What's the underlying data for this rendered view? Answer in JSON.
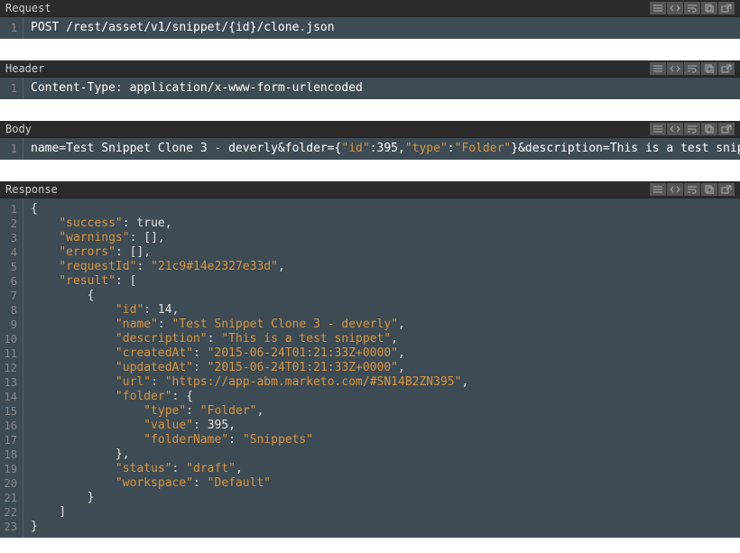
{
  "panels": {
    "request": {
      "title": "Request",
      "lines": [
        "1"
      ],
      "tokens": [
        [
          {
            "t": "POST /rest/asset/v1/snippet/{id}/clone.json",
            "c": "tok-ws"
          }
        ]
      ]
    },
    "header": {
      "title": "Header",
      "lines": [
        "1"
      ],
      "tokens": [
        [
          {
            "t": "Content-Type: application/x-www-form-urlencoded",
            "c": "tok-ws"
          }
        ]
      ]
    },
    "body": {
      "title": "Body",
      "lines": [
        "1"
      ],
      "tokens": [
        [
          {
            "t": "name=Test Snippet Clone 3 - deverly&folder={",
            "c": "tok-ws"
          },
          {
            "t": "\"id\"",
            "c": "tok-bkey"
          },
          {
            "t": ":395,",
            "c": "tok-ws"
          },
          {
            "t": "\"type\"",
            "c": "tok-bkey"
          },
          {
            "t": ":",
            "c": "tok-ws"
          },
          {
            "t": "\"Folder\"",
            "c": "tok-bkey"
          },
          {
            "t": "}&description=This is a test snippet",
            "c": "tok-ws"
          }
        ]
      ]
    },
    "response": {
      "title": "Response",
      "lines": [
        "1",
        "2",
        "3",
        "4",
        "5",
        "6",
        "7",
        "8",
        "9",
        "10",
        "11",
        "12",
        "13",
        "14",
        "15",
        "16",
        "17",
        "18",
        "19",
        "20",
        "21",
        "22",
        "23"
      ],
      "tokens": [
        [
          {
            "t": "{",
            "c": "tok-punc"
          }
        ],
        [
          {
            "t": "    ",
            "c": ""
          },
          {
            "t": "\"success\"",
            "c": "tok-key"
          },
          {
            "t": ": ",
            "c": "tok-punc"
          },
          {
            "t": "true",
            "c": "tok-bool"
          },
          {
            "t": ",",
            "c": "tok-punc"
          }
        ],
        [
          {
            "t": "    ",
            "c": ""
          },
          {
            "t": "\"warnings\"",
            "c": "tok-key"
          },
          {
            "t": ": [],",
            "c": "tok-punc"
          }
        ],
        [
          {
            "t": "    ",
            "c": ""
          },
          {
            "t": "\"errors\"",
            "c": "tok-key"
          },
          {
            "t": ": [],",
            "c": "tok-punc"
          }
        ],
        [
          {
            "t": "    ",
            "c": ""
          },
          {
            "t": "\"requestId\"",
            "c": "tok-key"
          },
          {
            "t": ": ",
            "c": "tok-punc"
          },
          {
            "t": "\"21c9#14e2327e33d\"",
            "c": "tok-str"
          },
          {
            "t": ",",
            "c": "tok-punc"
          }
        ],
        [
          {
            "t": "    ",
            "c": ""
          },
          {
            "t": "\"result\"",
            "c": "tok-key"
          },
          {
            "t": ": [",
            "c": "tok-punc"
          }
        ],
        [
          {
            "t": "        {",
            "c": "tok-punc"
          }
        ],
        [
          {
            "t": "            ",
            "c": ""
          },
          {
            "t": "\"id\"",
            "c": "tok-key"
          },
          {
            "t": ": ",
            "c": "tok-punc"
          },
          {
            "t": "14",
            "c": "tok-num"
          },
          {
            "t": ",",
            "c": "tok-punc"
          }
        ],
        [
          {
            "t": "            ",
            "c": ""
          },
          {
            "t": "\"name\"",
            "c": "tok-key"
          },
          {
            "t": ": ",
            "c": "tok-punc"
          },
          {
            "t": "\"Test Snippet Clone 3 - deverly\"",
            "c": "tok-str"
          },
          {
            "t": ",",
            "c": "tok-punc"
          }
        ],
        [
          {
            "t": "            ",
            "c": ""
          },
          {
            "t": "\"description\"",
            "c": "tok-key"
          },
          {
            "t": ": ",
            "c": "tok-punc"
          },
          {
            "t": "\"This is a test snippet\"",
            "c": "tok-str"
          },
          {
            "t": ",",
            "c": "tok-punc"
          }
        ],
        [
          {
            "t": "            ",
            "c": ""
          },
          {
            "t": "\"createdAt\"",
            "c": "tok-key"
          },
          {
            "t": ": ",
            "c": "tok-punc"
          },
          {
            "t": "\"2015-06-24T01:21:33Z+0000\"",
            "c": "tok-str"
          },
          {
            "t": ",",
            "c": "tok-punc"
          }
        ],
        [
          {
            "t": "            ",
            "c": ""
          },
          {
            "t": "\"updatedAt\"",
            "c": "tok-key"
          },
          {
            "t": ": ",
            "c": "tok-punc"
          },
          {
            "t": "\"2015-06-24T01:21:33Z+0000\"",
            "c": "tok-str"
          },
          {
            "t": ",",
            "c": "tok-punc"
          }
        ],
        [
          {
            "t": "            ",
            "c": ""
          },
          {
            "t": "\"url\"",
            "c": "tok-key"
          },
          {
            "t": ": ",
            "c": "tok-punc"
          },
          {
            "t": "\"https://app-abm.marketo.com/#SN14B2ZN395\"",
            "c": "tok-str"
          },
          {
            "t": ",",
            "c": "tok-punc"
          }
        ],
        [
          {
            "t": "            ",
            "c": ""
          },
          {
            "t": "\"folder\"",
            "c": "tok-key"
          },
          {
            "t": ": {",
            "c": "tok-punc"
          }
        ],
        [
          {
            "t": "                ",
            "c": ""
          },
          {
            "t": "\"type\"",
            "c": "tok-key"
          },
          {
            "t": ": ",
            "c": "tok-punc"
          },
          {
            "t": "\"Folder\"",
            "c": "tok-str"
          },
          {
            "t": ",",
            "c": "tok-punc"
          }
        ],
        [
          {
            "t": "                ",
            "c": ""
          },
          {
            "t": "\"value\"",
            "c": "tok-key"
          },
          {
            "t": ": ",
            "c": "tok-punc"
          },
          {
            "t": "395",
            "c": "tok-num"
          },
          {
            "t": ",",
            "c": "tok-punc"
          }
        ],
        [
          {
            "t": "                ",
            "c": ""
          },
          {
            "t": "\"folderName\"",
            "c": "tok-key"
          },
          {
            "t": ": ",
            "c": "tok-punc"
          },
          {
            "t": "\"Snippets\"",
            "c": "tok-str"
          }
        ],
        [
          {
            "t": "            },",
            "c": "tok-punc"
          }
        ],
        [
          {
            "t": "            ",
            "c": ""
          },
          {
            "t": "\"status\"",
            "c": "tok-key"
          },
          {
            "t": ": ",
            "c": "tok-punc"
          },
          {
            "t": "\"draft\"",
            "c": "tok-str"
          },
          {
            "t": ",",
            "c": "tok-punc"
          }
        ],
        [
          {
            "t": "            ",
            "c": ""
          },
          {
            "t": "\"workspace\"",
            "c": "tok-key"
          },
          {
            "t": ": ",
            "c": "tok-punc"
          },
          {
            "t": "\"Default\"",
            "c": "tok-str"
          }
        ],
        [
          {
            "t": "        }",
            "c": "tok-punc"
          }
        ],
        [
          {
            "t": "    ]",
            "c": "tok-punc"
          }
        ],
        [
          {
            "t": "}",
            "c": "tok-punc"
          }
        ]
      ]
    }
  },
  "toolbar_icons": [
    "hamburger",
    "code",
    "wrap",
    "copy",
    "popout"
  ]
}
